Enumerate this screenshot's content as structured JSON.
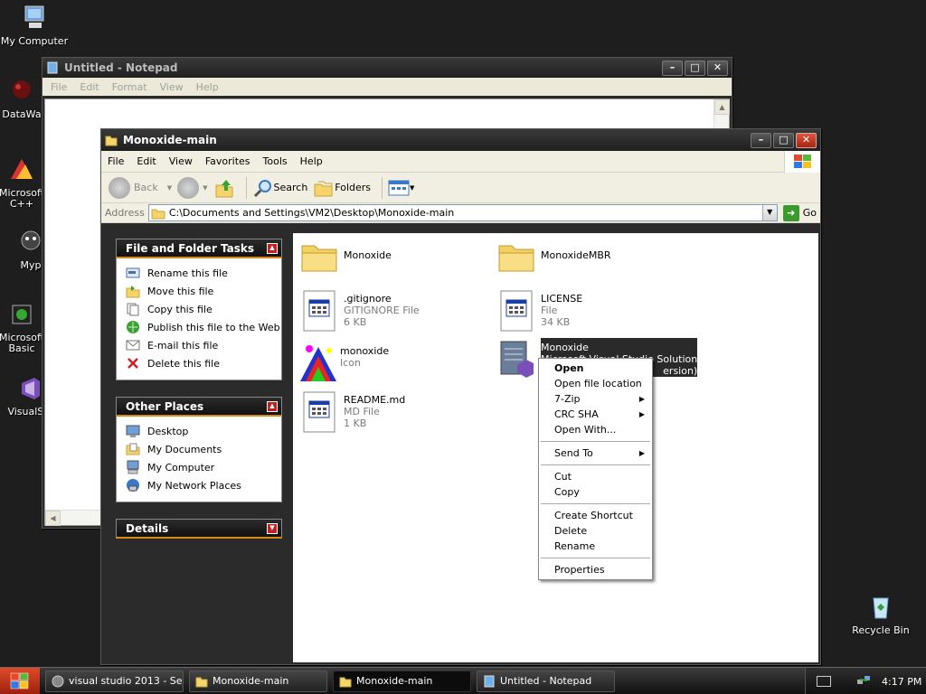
{
  "desktop": {
    "icons": [
      {
        "label": "My Computer"
      },
      {
        "label": "DataWa"
      },
      {
        "label": "Microsoft C++"
      },
      {
        "label": "Myp"
      },
      {
        "label": "Microsoft Basic"
      },
      {
        "label": "VisualStu"
      },
      {
        "label": "Recycle Bin"
      }
    ]
  },
  "notepad": {
    "title": "Untitled - Notepad",
    "menu": [
      "File",
      "Edit",
      "Format",
      "View",
      "Help"
    ]
  },
  "explorer": {
    "title": "Monoxide-main",
    "menu": [
      "File",
      "Edit",
      "View",
      "Favorites",
      "Tools",
      "Help"
    ],
    "toolbar": {
      "back": "Back",
      "search": "Search",
      "folders": "Folders"
    },
    "address_label": "Address",
    "address_value": "C:\\Documents and Settings\\VM2\\Desktop\\Monoxide-main",
    "go_label": "Go",
    "file_tasks": {
      "title": "File and Folder Tasks",
      "items": [
        "Rename this file",
        "Move this file",
        "Copy this file",
        "Publish this file to the Web",
        "E-mail this file",
        "Delete this file"
      ]
    },
    "other_places": {
      "title": "Other Places",
      "items": [
        "Desktop",
        "My Documents",
        "My Computer",
        "My Network Places"
      ]
    },
    "details": {
      "title": "Details"
    },
    "files": [
      {
        "name": "Monoxide",
        "type": "",
        "size": ""
      },
      {
        "name": "MonoxideMBR",
        "type": "",
        "size": ""
      },
      {
        "name": ".gitignore",
        "type": "GITIGNORE File",
        "size": "6 KB"
      },
      {
        "name": "LICENSE",
        "type": "File",
        "size": "34 KB"
      },
      {
        "name": "monoxide",
        "type": "Icon",
        "size": ""
      },
      {
        "name": "Monoxide",
        "type": "Microsoft Visual Studio Solution",
        "size": "ersion)"
      },
      {
        "name": "README.md",
        "type": "MD File",
        "size": "1 KB"
      }
    ]
  },
  "context_menu": {
    "items": [
      "Open",
      "Open file location",
      "7-Zip",
      "CRC SHA",
      "Open With...",
      "Send To",
      "Cut",
      "Copy",
      "Create Shortcut",
      "Delete",
      "Rename",
      "Properties"
    ]
  },
  "taskbar": {
    "tasks": [
      "visual studio 2013 - Se...",
      "Monoxide-main",
      "Monoxide-main",
      "Untitled - Notepad"
    ],
    "clock": "4:17 PM"
  },
  "colors": {
    "accent_orange": "#d58a13",
    "close_red": "#c0341c",
    "selection": "#2a2a2a"
  }
}
